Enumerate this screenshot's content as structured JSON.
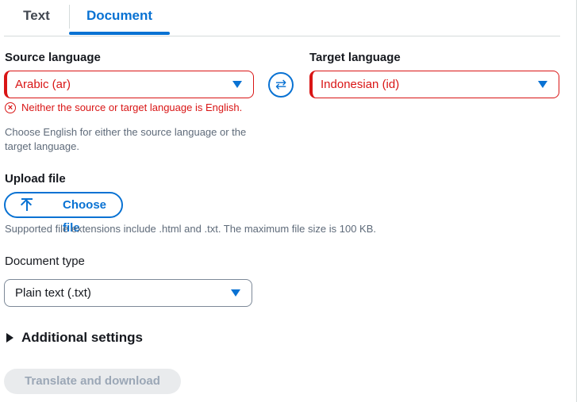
{
  "tabs": [
    {
      "label": "Text",
      "active": false
    },
    {
      "label": "Document",
      "active": true
    }
  ],
  "source": {
    "label": "Source language",
    "value": "Arabic (ar)",
    "error": "Neither the source or target language is English.",
    "help_line1": "Choose English for either the source language or the",
    "help_line2": "target language."
  },
  "swap": {
    "icon": "swap-icon",
    "glyph": "⇄"
  },
  "target": {
    "label": "Target language",
    "value": "Indonesian (id)"
  },
  "upload": {
    "label": "Upload file",
    "button": "Choose file",
    "help": "Supported file extensions include .html and .txt. The maximum file size is 100 KB."
  },
  "doc_type": {
    "label": "Document type",
    "value": "Plain text (.txt)"
  },
  "additional_settings": "Additional settings",
  "translate_button": "Translate and download",
  "colors": {
    "accent": "#0972d3",
    "error": "#d91515",
    "disabled_bg": "#e9ebed"
  }
}
